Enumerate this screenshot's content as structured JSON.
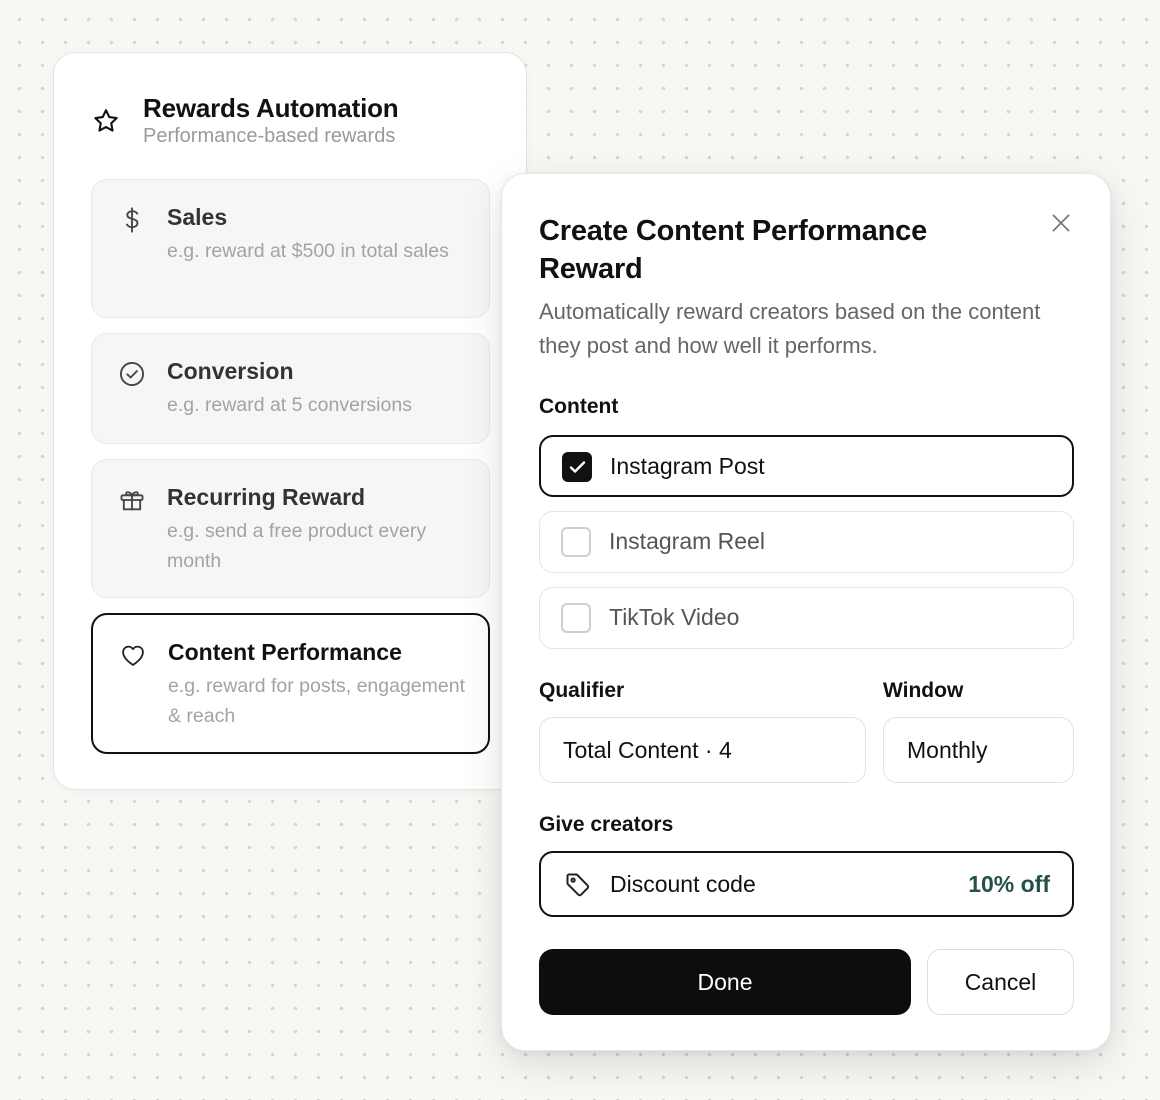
{
  "panel": {
    "title": "Rewards Automation",
    "subtitle": "Performance-based rewards",
    "icon": "star-icon",
    "options": [
      {
        "title": "Sales",
        "desc": "e.g. reward at $500 in total sales",
        "icon": "dollar-icon",
        "selected": false
      },
      {
        "title": "Conversion",
        "desc": "e.g. reward at 5 conversions",
        "icon": "check-circle-icon",
        "selected": false
      },
      {
        "title": "Recurring Reward",
        "desc": "e.g. send a free product every month",
        "icon": "gift-icon",
        "selected": false
      },
      {
        "title": "Content Performance",
        "desc": "e.g. reward for posts, engagement & reach",
        "icon": "heart-icon",
        "selected": true
      }
    ]
  },
  "modal": {
    "title": "Create Content Performance Reward",
    "description": "Automatically reward creators based on the content they post and how well it performs.",
    "close_icon": "close-icon",
    "content_label": "Content",
    "content_options": [
      {
        "label": "Instagram Post",
        "checked": true
      },
      {
        "label": "Instagram Reel",
        "checked": false
      },
      {
        "label": "TikTok Video",
        "checked": false
      }
    ],
    "qualifier_label": "Qualifier",
    "qualifier_value": "Total Content · 4",
    "window_label": "Window",
    "window_value": "Monthly",
    "give_label": "Give creators",
    "give_type": "Discount code",
    "give_value": "10% off",
    "done_label": "Done",
    "cancel_label": "Cancel"
  },
  "colors": {
    "accent": "#111111",
    "discount_value": "#24504a",
    "muted_text": "#a3a3a3",
    "background": "#f8f7f4"
  }
}
